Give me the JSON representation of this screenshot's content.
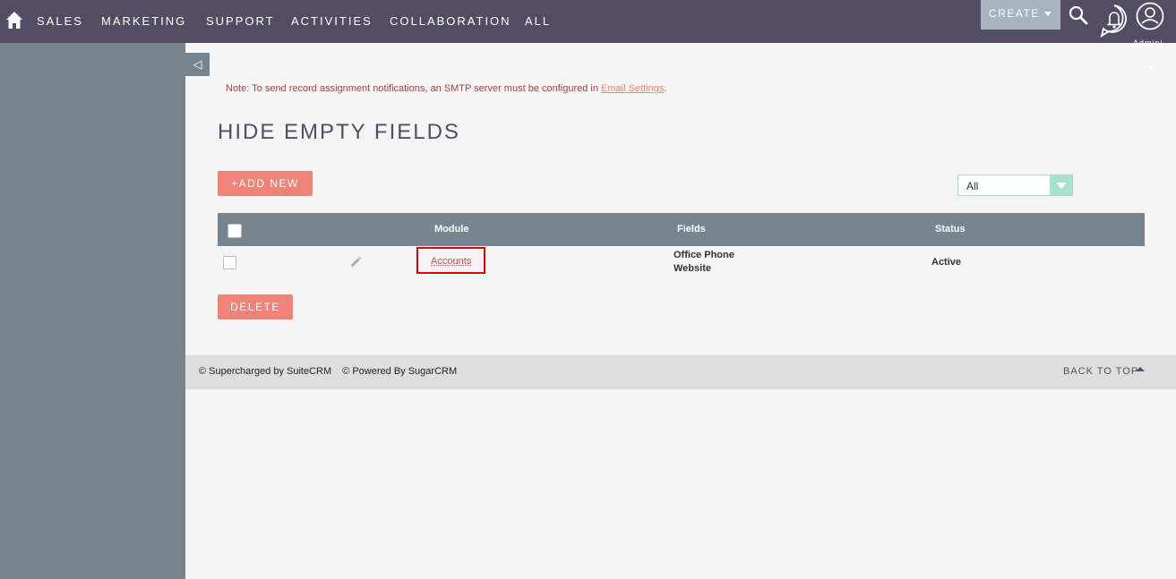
{
  "nav": {
    "items": [
      "SALES",
      "MARKETING",
      "SUPPORT",
      "ACTIVITIES",
      "COLLABORATION",
      "ALL"
    ],
    "create_label": "CREATE",
    "user_label": "Admini"
  },
  "sidebar": {
    "collapse_glyph": "◁"
  },
  "notice": {
    "text": "Note: To send record assignment notifications, an SMTP server must be configured in ",
    "link": "Email Settings",
    "suffix": "."
  },
  "page": {
    "title": "HIDE EMPTY FIELDS",
    "add_button": "+ADD NEW",
    "delete_button": "DELETE",
    "filter_value": "All"
  },
  "table": {
    "columns": {
      "module": "Module",
      "fields": "Fields",
      "status": "Status"
    },
    "rows": [
      {
        "module": "Accounts",
        "fields": [
          "Office Phone",
          "Website"
        ],
        "status": "Active"
      }
    ]
  },
  "footer": {
    "supercharged": "© Supercharged by SuiteCRM",
    "powered": "© Powered By SugarCRM",
    "back_to_top": "BACK TO TOP"
  },
  "colors": {
    "topbar": "#534d64",
    "sidebar": "#778591",
    "accent": "#f08377",
    "highlight": "#e0000c"
  }
}
